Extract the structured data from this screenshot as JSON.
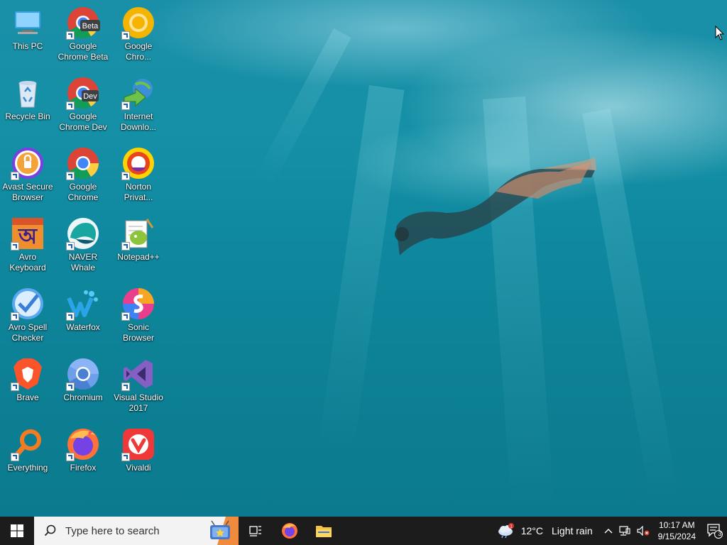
{
  "desktop": {
    "icons": [
      {
        "label": "This PC",
        "icon": "this-pc-icon"
      },
      {
        "label": "Google Chrome Beta",
        "icon": "chrome-beta-icon",
        "badge": "Beta"
      },
      {
        "label": "Google Chro...",
        "icon": "chrome-canary-icon"
      },
      {
        "label": "Recycle Bin",
        "icon": "recycle-bin-icon"
      },
      {
        "label": "Google Chrome Dev",
        "icon": "chrome-dev-icon",
        "badge": "Dev"
      },
      {
        "label": "Internet Downlo...",
        "icon": "internet-download-manager-icon"
      },
      {
        "label": "Avast Secure Browser",
        "icon": "avast-secure-browser-icon"
      },
      {
        "label": "Google Chrome",
        "icon": "chrome-icon"
      },
      {
        "label": "Norton Privat...",
        "icon": "norton-private-browser-icon"
      },
      {
        "label": "Avro Keyboard",
        "icon": "avro-keyboard-icon"
      },
      {
        "label": "NAVER Whale",
        "icon": "naver-whale-icon"
      },
      {
        "label": "Notepad++",
        "icon": "notepad-plus-plus-icon"
      },
      {
        "label": "Avro Spell Checker",
        "icon": "avro-spell-checker-icon"
      },
      {
        "label": "Waterfox",
        "icon": "waterfox-icon"
      },
      {
        "label": "Sonic Browser",
        "icon": "sonic-browser-icon"
      },
      {
        "label": "Brave",
        "icon": "brave-icon"
      },
      {
        "label": "Chromium",
        "icon": "chromium-icon"
      },
      {
        "label": "Visual Studio 2017",
        "icon": "visual-studio-icon"
      },
      {
        "label": "Everything",
        "icon": "everything-search-icon"
      },
      {
        "label": "Firefox",
        "icon": "firefox-icon"
      },
      {
        "label": "Vivaldi",
        "icon": "vivaldi-icon"
      }
    ]
  },
  "taskbar": {
    "search_placeholder": "Type here to search",
    "weather_temp": "12°C",
    "weather_desc": "Light rain",
    "weather_badge": "1",
    "clock_time": "10:17 AM",
    "clock_date": "9/15/2024",
    "notification_count": "3"
  },
  "colors": {
    "taskbar_bg": "#1c1c1c",
    "wallpaper": "#1590a6",
    "start_blue": "#ffffff"
  }
}
